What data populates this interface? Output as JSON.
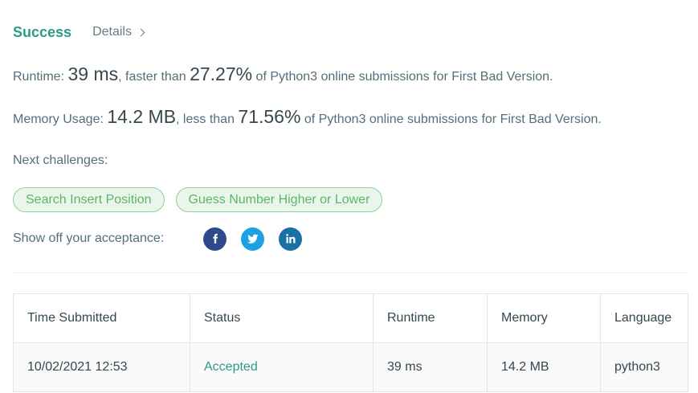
{
  "header": {
    "status": "Success",
    "details_label": "Details"
  },
  "runtime": {
    "label": "Runtime:",
    "value": "39 ms",
    "comparison": ", faster than",
    "percent": "27.27%",
    "suffix": "of Python3 online submissions for First Bad Version."
  },
  "memory": {
    "label": "Memory Usage:",
    "value": "14.2 MB",
    "comparison": ", less than",
    "percent": "71.56%",
    "suffix": "of Python3 online submissions for First Bad Version."
  },
  "next": {
    "label": "Next challenges:",
    "challenges": [
      "Search Insert Position",
      "Guess Number Higher or Lower"
    ]
  },
  "share": {
    "label": "Show off your acceptance:",
    "icons": [
      "facebook-icon",
      "twitter-icon",
      "linkedin-icon"
    ],
    "colors": {
      "facebook": "#2f4a8a",
      "twitter": "#1da1e2",
      "linkedin": "#1a6fa3"
    }
  },
  "table": {
    "headers": [
      "Time Submitted",
      "Status",
      "Runtime",
      "Memory",
      "Language"
    ],
    "rows": [
      [
        "10/02/2021 12:53",
        "Accepted",
        "39 ms",
        "14.2 MB",
        "python3"
      ]
    ]
  },
  "colors": {
    "accent": "#2b9a88",
    "pill_text": "#5cb566",
    "pill_border": "#8fd095",
    "pill_bg": "#eaf6ec"
  }
}
